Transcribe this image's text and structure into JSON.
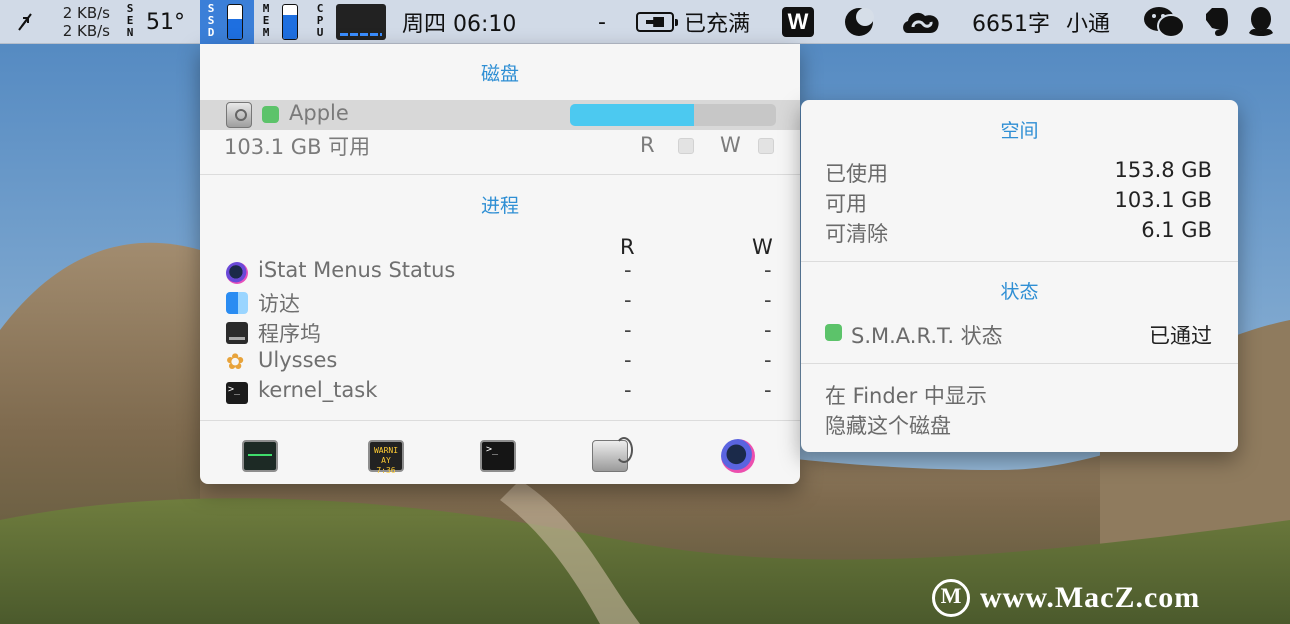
{
  "menubar": {
    "network_upload": "2 KB/s",
    "network_download": "2 KB/s",
    "sensors_label": "SEN",
    "temperature": "51°",
    "ssd_label": "SSD",
    "memory_label": "MEM",
    "cpu_label": "CPU",
    "datetime": "周四 06:10",
    "dash": "-",
    "battery_status": "已充满",
    "word_count": "6651字",
    "user": "小通",
    "icons": [
      "network-arrows-icon",
      "sensors-icon",
      "ssd-meter",
      "memory-meter",
      "cpu-graph",
      "battery-icon",
      "wps-icon",
      "moon-icon",
      "creative-cloud-icon",
      "wechat-icon",
      "evernote-icon",
      "qq-icon"
    ],
    "ssd_fill_pct": 60,
    "mem_fill_pct": 70
  },
  "panel": {
    "disk_section_title": "磁盘",
    "disk": {
      "name": "Apple",
      "free_text": "103.1 GB 可用",
      "usage_pct": 60,
      "read_label": "R",
      "write_label": "W"
    },
    "process_section_title": "进程",
    "columns": {
      "read": "R",
      "write": "W"
    },
    "processes": [
      {
        "name": "iStat Menus Status",
        "read": "-",
        "write": "-",
        "icon": "istat-icon"
      },
      {
        "name": "访达",
        "read": "-",
        "write": "-",
        "icon": "finder-icon"
      },
      {
        "name": "程序坞",
        "read": "-",
        "write": "-",
        "icon": "dock-icon"
      },
      {
        "name": "Ulysses",
        "read": "-",
        "write": "-",
        "icon": "butterfly-icon"
      },
      {
        "name": "kernel_task",
        "read": "-",
        "write": "-",
        "icon": "terminal-icon"
      }
    ],
    "console_text": "WARNI AY 7:36",
    "terminal_prompt": ">_"
  },
  "popover": {
    "space_title": "空间",
    "used_label": "已使用",
    "used_value": "153.8 GB",
    "available_label": "可用",
    "available_value": "103.1 GB",
    "purgeable_label": "可清除",
    "purgeable_value": "6.1 GB",
    "status_title": "状态",
    "smart_label": "S.M.A.R.T. 状态",
    "smart_value": "已通过",
    "show_in_finder": "在 Finder 中显示",
    "hide_disk": "隐藏这个磁盘"
  },
  "watermark": {
    "text": "www.MacZ.com"
  },
  "colors": {
    "accent": "#2f8fd4",
    "usage_bar": "#4cc9f0",
    "status_green": "#5cc36a",
    "ssd_highlight": "#3b7fd8"
  }
}
